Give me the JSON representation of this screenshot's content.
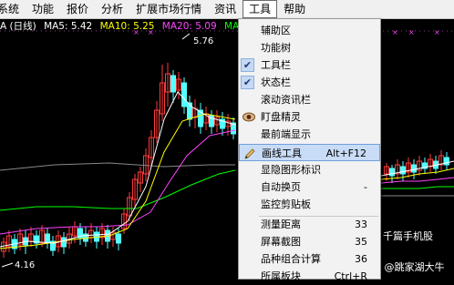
{
  "menubar": {
    "items": [
      "系统",
      "功能",
      "报价",
      "分析",
      "扩展市场行情",
      "资讯",
      "工具",
      "帮助"
    ],
    "active_index": 6
  },
  "chart": {
    "title": "A (日线)",
    "indicators": [
      {
        "label": "MA5: 5.42",
        "color": "#ffffff"
      },
      {
        "label": "MA10: 5.25",
        "color": "#ffff00"
      },
      {
        "label": "MA20: 5.09",
        "color": "#ff44ff"
      },
      {
        "label": "MA60: 4",
        "color": "#00ff00"
      }
    ],
    "high_label": "5.76",
    "low_label": "4.16",
    "colors": {
      "up": "#ff3a3a",
      "down": "#54ffff",
      "ma5": "#ffffff",
      "ma10": "#ffff00",
      "ma20": "#ff44ff",
      "ma60": "#00ff00",
      "ma_long": "#888888"
    }
  },
  "menu": {
    "items": [
      {
        "label": "辅助区",
        "checked": false
      },
      {
        "label": "功能树",
        "checked": false
      },
      {
        "label": "工具栏",
        "checked": true
      },
      {
        "label": "状态栏",
        "checked": true
      },
      {
        "label": "滚动资讯栏",
        "checked": false
      },
      {
        "label": "盯盘精灵",
        "icon": "eye-icon"
      },
      {
        "label": "最前端显示",
        "checked": false
      },
      {
        "label": "画线工具",
        "shortcut": "Alt+F12",
        "icon": "pencil-icon",
        "highlighted": true
      },
      {
        "label": "显隐图形标识"
      },
      {
        "label": "自动换页",
        "shortcut": "-"
      },
      {
        "label": "监控剪贴板"
      },
      {
        "label": "测量距离",
        "shortcut": "33"
      },
      {
        "label": "屏幕截图",
        "shortcut": "35"
      },
      {
        "label": "品种组合计算",
        "shortcut": "36"
      },
      {
        "label": "所属板块",
        "shortcut": "Ctrl+R"
      }
    ]
  },
  "watermark": {
    "top": "千篇手机股",
    "bottom": "头条 @跳家湖大牛"
  }
}
